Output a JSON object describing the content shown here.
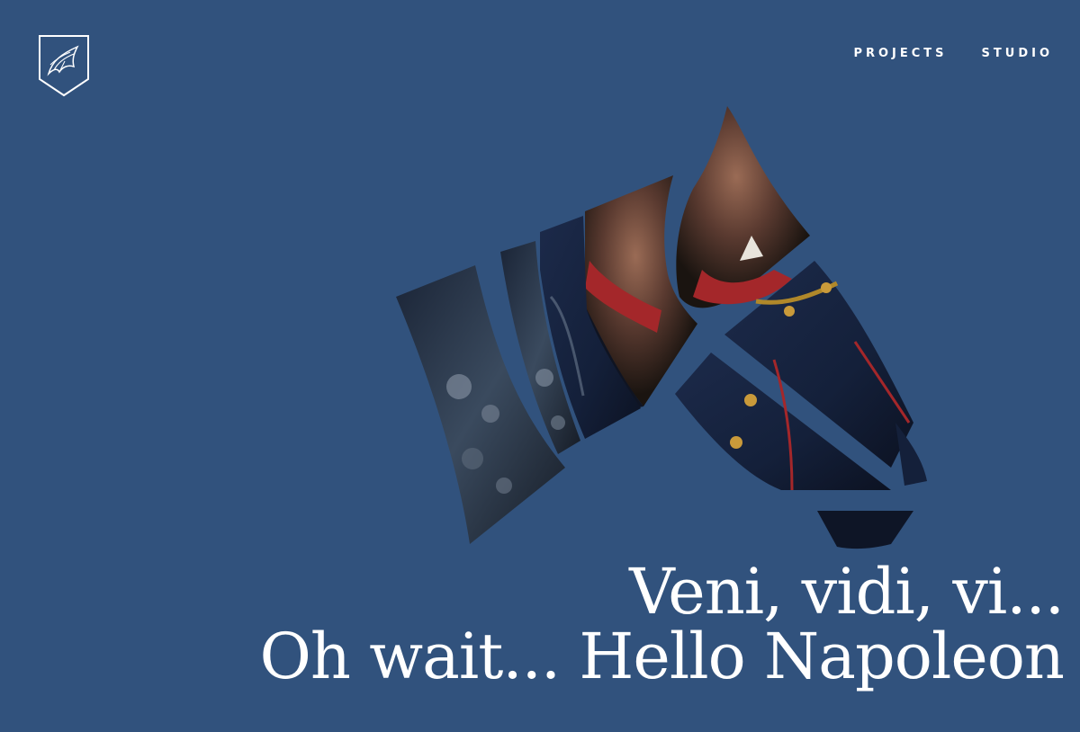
{
  "logo": {
    "icon": "fox-shield-logo-icon",
    "color": "#ffffff"
  },
  "nav": {
    "items": [
      {
        "label": "PROJECTS"
      },
      {
        "label": "STUDIO"
      }
    ]
  },
  "hero": {
    "image_icon": "horse-head-mosaic-photo",
    "headline_line1": "Veni, vidi, vi...",
    "headline_line2": "Oh wait... Hello Napoleon"
  },
  "colors": {
    "background": "#31527d",
    "text": "#ffffff"
  }
}
